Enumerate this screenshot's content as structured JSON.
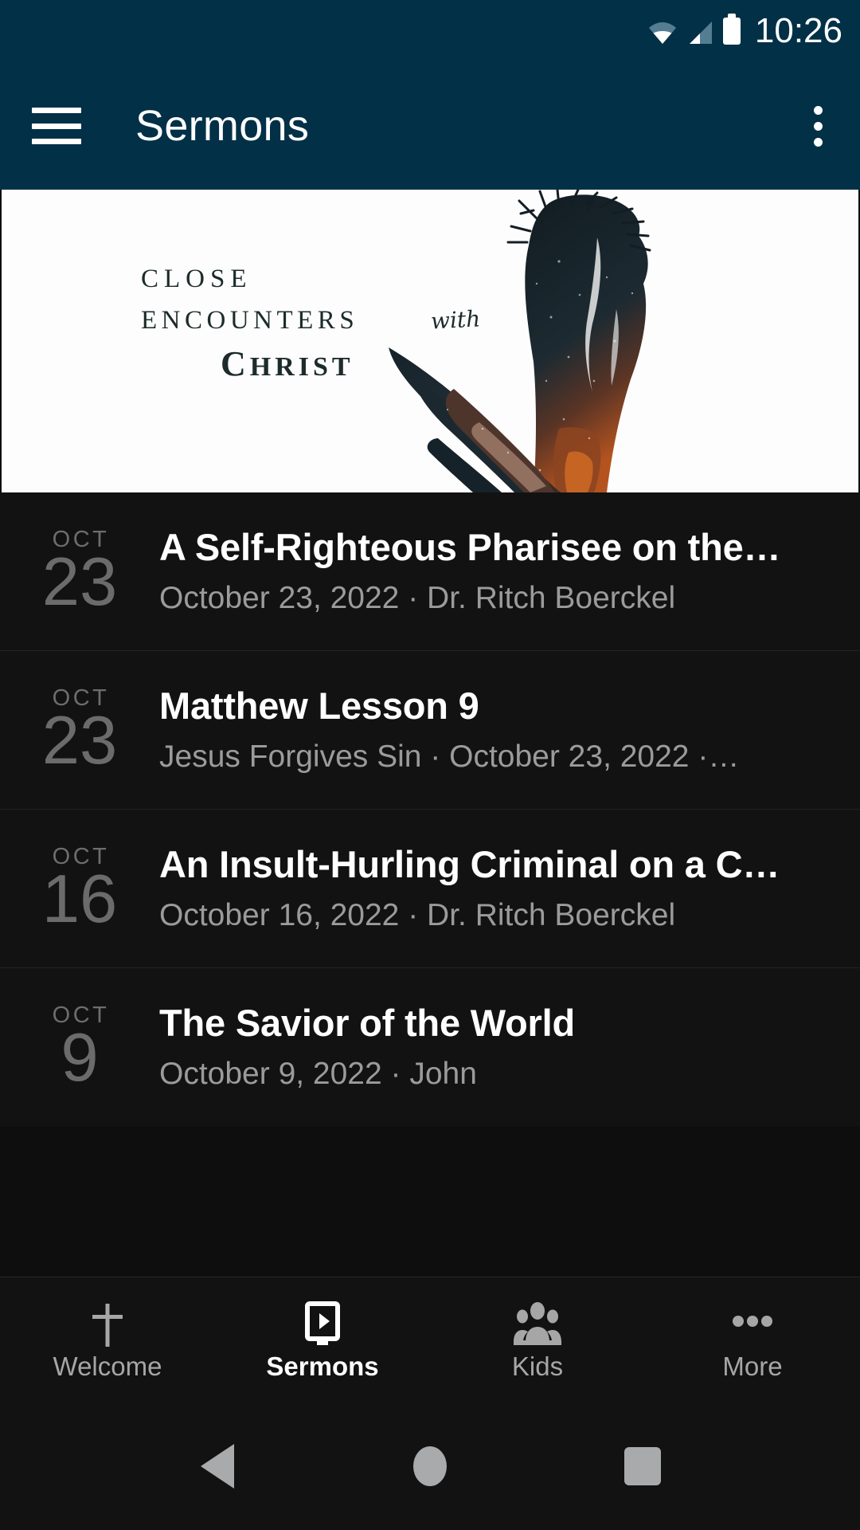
{
  "status_bar": {
    "time": "10:26",
    "icons": [
      "wifi-icon",
      "cellular-signal-icon",
      "battery-icon"
    ]
  },
  "app_bar": {
    "title": "Sermons",
    "menu_icon": "hamburger-menu-icon",
    "overflow_icon": "overflow-menu-icon",
    "background_color": "#023047"
  },
  "banner": {
    "line1": "CLOSE",
    "line2": "ENCOUNTERS",
    "script": "with",
    "line3_cap": "C",
    "line3_rest": "HRIST",
    "alt": "Close Encounters with Christ series artwork"
  },
  "sermons": [
    {
      "month": "OCT",
      "day": "23",
      "title": "A Self-Righteous Pharisee on the…",
      "subtitle": "October 23, 2022 · Dr. Ritch Boerckel"
    },
    {
      "month": "OCT",
      "day": "23",
      "title": "Matthew Lesson 9",
      "subtitle": "Jesus Forgives Sin · October 23, 2022 ·…"
    },
    {
      "month": "OCT",
      "day": "16",
      "title": "An Insult-Hurling Criminal on a C…",
      "subtitle": "October 16, 2022 · Dr. Ritch Boerckel"
    },
    {
      "month": "OCT",
      "day": "9",
      "title": "The Savior of the World",
      "subtitle": "October 9, 2022 · John"
    }
  ],
  "tabs": [
    {
      "label": "Welcome",
      "icon": "cross-icon",
      "active": false
    },
    {
      "label": "Sermons",
      "icon": "video-play-icon",
      "active": true
    },
    {
      "label": "Kids",
      "icon": "people-group-icon",
      "active": false
    },
    {
      "label": "More",
      "icon": "ellipsis-icon",
      "active": false
    }
  ],
  "system_nav": {
    "back": "back-triangle-icon",
    "home": "home-circle-icon",
    "recents": "recents-square-icon"
  },
  "colors": {
    "accent": "#023047",
    "surface": "#121212",
    "text_primary": "#ffffff",
    "text_secondary": "#9b9b9b",
    "date_gray": "#6b6b6b"
  }
}
